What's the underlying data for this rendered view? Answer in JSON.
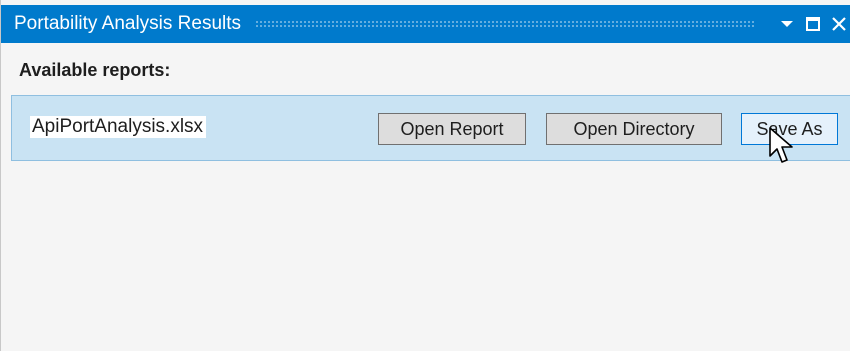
{
  "window": {
    "title": "Portability Analysis Results",
    "controls": {
      "dropdown_icon": "chevron-down-icon",
      "maximize_icon": "maximize-icon",
      "close_icon": "close-icon"
    },
    "accent_color": "#007acc"
  },
  "main": {
    "section_label": "Available reports:",
    "reports": [
      {
        "file_name": "ApiPortAnalysis.xlsx",
        "actions": {
          "open_report": "Open Report",
          "open_directory": "Open Directory",
          "save_as": "Save As"
        }
      }
    ],
    "row_highlight_color": "#c9e3f3"
  }
}
